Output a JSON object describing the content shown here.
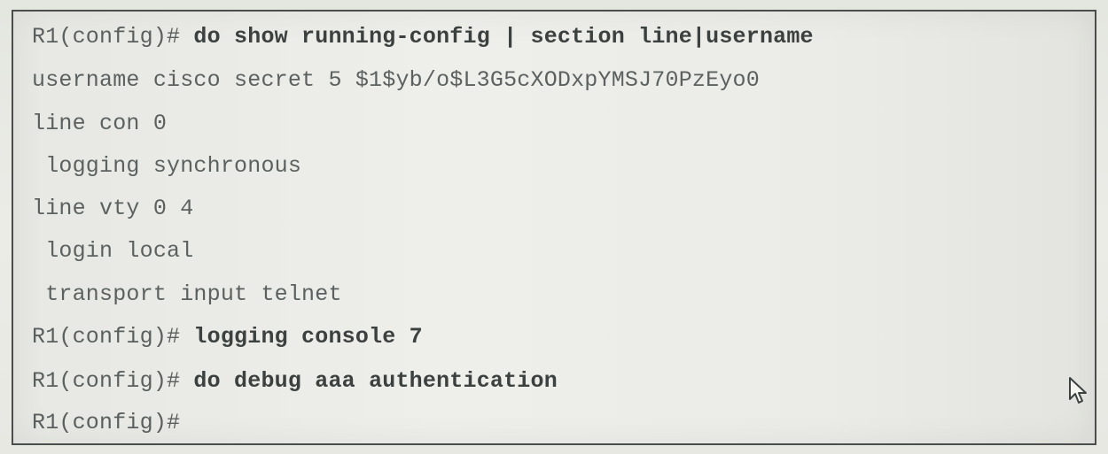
{
  "terminal": {
    "lines": [
      {
        "prompt": "R1(config)#",
        "cmd": " do show running-config | section line|username"
      },
      {
        "text": "username cisco secret 5 $1$yb/o$L3G5cXODxpYMSJ70PzEyo0"
      },
      {
        "text": "line con 0"
      },
      {
        "text": " logging synchronous"
      },
      {
        "text": "line vty 0 4"
      },
      {
        "text": " login local"
      },
      {
        "text": " transport input telnet"
      },
      {
        "prompt": "R1(config)#",
        "cmd": " logging console 7"
      },
      {
        "prompt": "R1(config)#",
        "cmd": " do debug aaa authentication"
      },
      {
        "prompt": "R1(config)#",
        "cmd": ""
      }
    ]
  },
  "icons": {
    "cursor": "mouse-pointer-icon"
  }
}
